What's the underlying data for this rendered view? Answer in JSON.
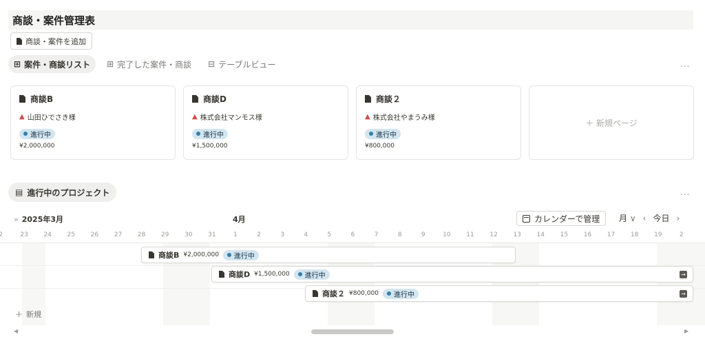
{
  "page": {
    "title": "商談・案件管理表"
  },
  "add_button": {
    "label": "商談・案件を追加"
  },
  "tabs": [
    {
      "label": "案件・商談リスト",
      "icon": "grid-icon",
      "active": true
    },
    {
      "label": "完了した案件・商談",
      "icon": "grid-icon",
      "active": false
    },
    {
      "label": "テーブルビュー",
      "icon": "table-icon",
      "active": false
    }
  ],
  "more_label": "...",
  "cards": [
    {
      "title": "商談B",
      "client": "山田ひでさき様",
      "status": "進行中",
      "amount": "¥2,000,000"
    },
    {
      "title": "商談D",
      "client": "株式会社マンモス様",
      "status": "進行中",
      "amount": "¥1,500,000"
    },
    {
      "title": "商談２",
      "client": "株式会社やまうみ様",
      "status": "進行中",
      "amount": "¥800,000"
    }
  ],
  "new_page_label": "＋ 新規ページ",
  "project_tab": {
    "label": "進行中のプロジェクト"
  },
  "timeline": {
    "year_month": "2025年3月",
    "next_month": "4月",
    "calendar_button": "カレンダーで管理",
    "view_select": "月",
    "today_button": "今日",
    "days": [
      "2",
      "23",
      "24",
      "25",
      "26",
      "27",
      "28",
      "29",
      "30",
      "31",
      "1",
      "2",
      "3",
      "4",
      "5",
      "6",
      "7",
      "8",
      "9",
      "10",
      "11",
      "12",
      "13",
      "14",
      "15",
      "16",
      "17",
      "18",
      "19",
      "2"
    ],
    "bars": [
      {
        "title": "商談B",
        "amount": "¥2,000,000",
        "status": "進行中"
      },
      {
        "title": "商談D",
        "amount": "¥1,500,000",
        "status": "進行中"
      },
      {
        "title": "商談２",
        "amount": "¥800,000",
        "status": "進行中"
      }
    ],
    "new_label": "新規"
  },
  "colors": {
    "status_bg": "#d3e5ef",
    "status_dot": "#337ea9",
    "person_icon": "#d44c47"
  }
}
